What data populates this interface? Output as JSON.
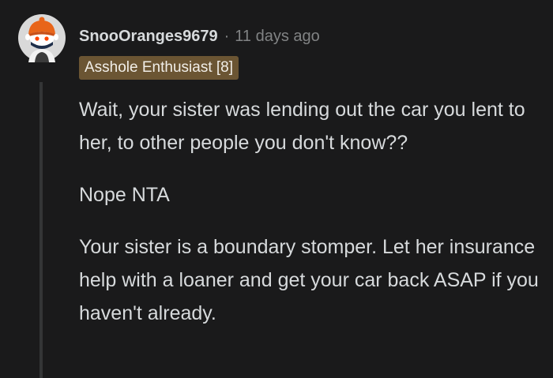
{
  "comment": {
    "author": "SnooOranges9679",
    "separator": "·",
    "timestamp": "11 days ago",
    "flair": "Asshole Enthusiast [8]",
    "paragraphs": [
      "Wait, your sister was lending out the car you lent to her, to other people you don't know??",
      "Nope NTA",
      "Your sister is a boundary stomper. Let her insurance help with a loaner and get your car back ASAP if you haven't already."
    ]
  },
  "colors": {
    "background": "#1a1a1b",
    "text": "#d7dadc",
    "meta": "#818384",
    "flair_bg": "#6b5533",
    "thread_line": "#343536"
  },
  "icons": {
    "avatar": "snoo-avatar-icon"
  }
}
